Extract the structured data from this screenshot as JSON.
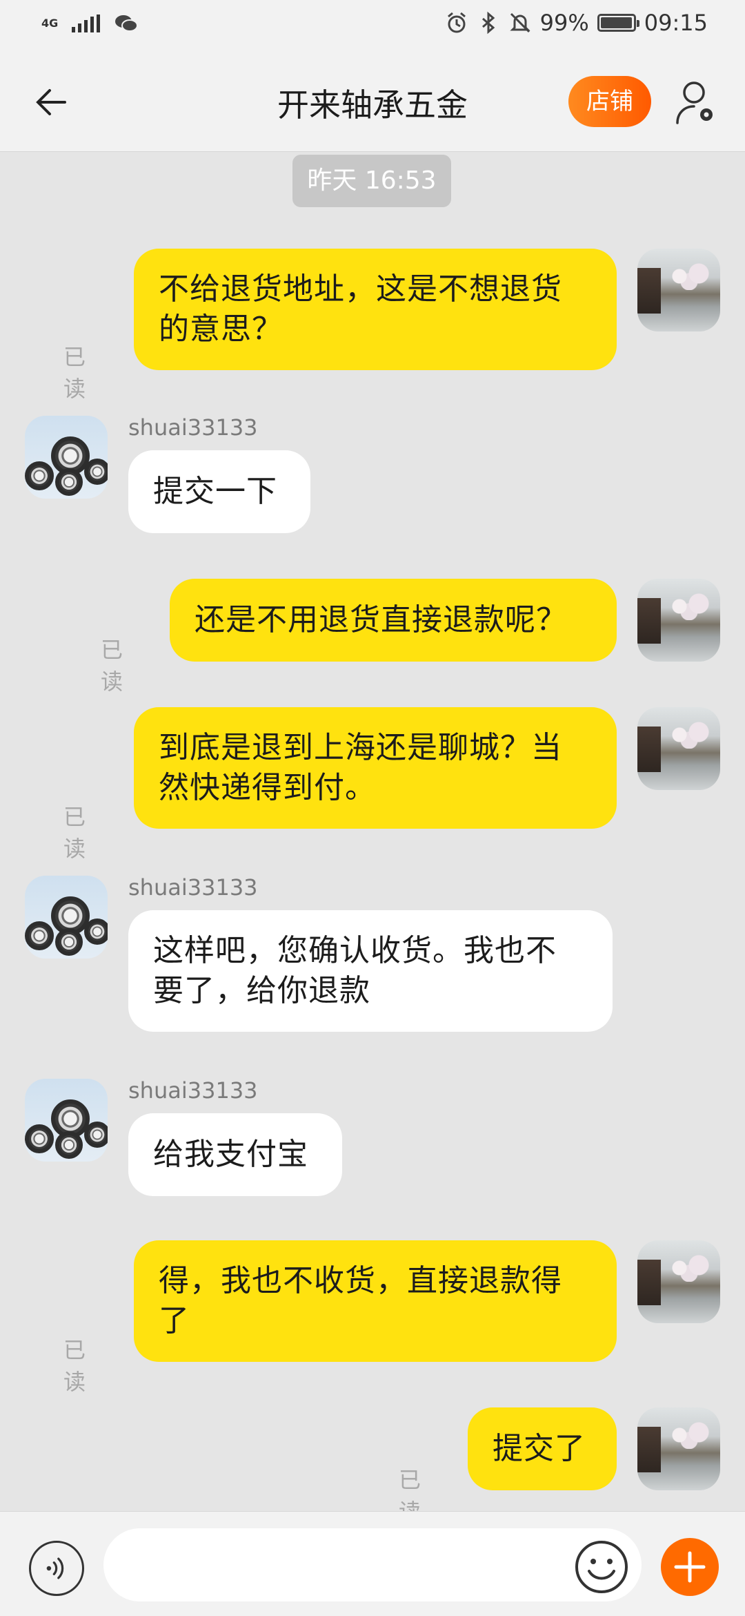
{
  "status_bar": {
    "network": "4G",
    "battery": "99%",
    "battery_level": 0.99,
    "time": "09:15",
    "icons": [
      "signal-icon",
      "wechat-icon",
      "alarm-icon",
      "bluetooth-icon",
      "mute-icon",
      "battery-icon"
    ]
  },
  "header": {
    "title": "开来轴承五金",
    "shop_button": "店铺",
    "icons": [
      "back-arrow-icon",
      "user-settings-icon"
    ]
  },
  "timestamp": "昨天  16:53",
  "messages": [
    {
      "from": "me",
      "text_lines": [
        "不给退货地址，这是不想退货",
        "的意思？"
      ],
      "status": "已读"
    },
    {
      "from": "them",
      "sender": "shuai33133",
      "text_lines": [
        "提交一下"
      ]
    },
    {
      "from": "me",
      "text_lines": [
        "还是不用退货直接退款呢？"
      ],
      "status": "已读"
    },
    {
      "from": "me",
      "text_lines": [
        "到底是退到上海还是聊城？当",
        "然快递得到付。"
      ],
      "status": "已读"
    },
    {
      "from": "them",
      "sender": "shuai33133",
      "text_lines": [
        "这样吧，您确认收货。我也不",
        "要了，给你退款"
      ]
    },
    {
      "from": "them",
      "sender": "shuai33133",
      "text_lines": [
        "给我支付宝"
      ]
    },
    {
      "from": "me",
      "text_lines": [
        "得，我也不收货，直接退款得",
        "了"
      ],
      "status": "已读"
    },
    {
      "from": "me",
      "text_lines": [
        "提交了"
      ],
      "status": "已读"
    }
  ],
  "input_bar": {
    "placeholder": "",
    "icons": [
      "voice-icon",
      "emoji-icon",
      "plus-icon"
    ]
  },
  "colors": {
    "my_bubble": "#ffe20f",
    "their_bubble": "#ffffff",
    "background": "#e5e5e5",
    "accent": "#ff6a00"
  }
}
